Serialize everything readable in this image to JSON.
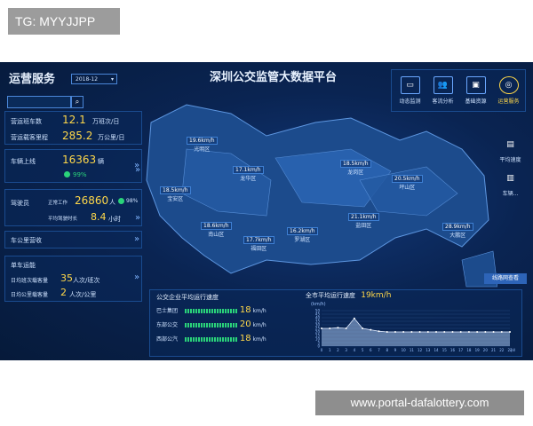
{
  "badge": "TG: MYYJJPP",
  "watermark": "www.portal-dafalottery.com",
  "header": {
    "title": "深圳公交监管大数据平台",
    "panel_title": "运营服务",
    "date": "2018-12"
  },
  "left": {
    "ops_vehicles_label": "营运班车数",
    "ops_vehicles_value": "12.1",
    "ops_vehicles_unit": "万班次/日",
    "ops_mileage_label": "营运载客里程",
    "ops_mileage_value": "285.2",
    "ops_mileage_unit": "万公里/日",
    "online_label": "车辆上线",
    "online_value": "16363",
    "online_unit": "辆",
    "online_pct": "99%",
    "drivers_label": "驾驶员",
    "drivers_working_label": "正常工作",
    "drivers_value": "26860",
    "drivers_unit": "人",
    "drivers_pct": "98%",
    "avg_drive_label": "平均驾驶时长",
    "avg_drive_value": "8.4",
    "avg_drive_unit": "小时",
    "revenue_label": "车公里营收",
    "single_ops_label": "单车运能",
    "daily_trips_label": "日均班次载客量",
    "daily_trips_value": "35",
    "daily_trips_unit": "人次/班次",
    "daily_km_label": "日均公里载客量",
    "daily_km_value": "2",
    "daily_km_unit": "人次/公里"
  },
  "top_buttons": [
    {
      "label": "动态监测"
    },
    {
      "label": "客流分析"
    },
    {
      "label": "基础资源"
    },
    {
      "label": "运营服务"
    }
  ],
  "side_buttons": [
    {
      "label": "平均速度"
    },
    {
      "label": "车辆..."
    }
  ],
  "districts": [
    {
      "name": "光明区",
      "speed": "19.6km/h"
    },
    {
      "name": "龙华区",
      "speed": "17.1km/h"
    },
    {
      "name": "龙岗区",
      "speed": "18.5km/h"
    },
    {
      "name": "坪山区",
      "speed": "20.5km/h"
    },
    {
      "name": "宝安区",
      "speed": "18.5km/h"
    },
    {
      "name": "南山区",
      "speed": "18.6km/h"
    },
    {
      "name": "福田区",
      "speed": "17.7km/h"
    },
    {
      "name": "罗湖区",
      "speed": "16.2km/h"
    },
    {
      "name": "盐田区",
      "speed": "21.1km/h"
    },
    {
      "name": "大鹏区",
      "speed": "28.9km/h"
    }
  ],
  "btn_more": "线路网查看",
  "bottom_left": {
    "title": "公交企业平均运行速度",
    "rows": [
      {
        "name": "巴士集团",
        "value": "18",
        "unit": "km/h"
      },
      {
        "name": "东部公交",
        "value": "20",
        "unit": "km/h"
      },
      {
        "name": "西部公汽",
        "value": "18",
        "unit": "km/h"
      }
    ]
  },
  "bottom_right": {
    "title": "全市平均运行速度",
    "value": "19km/h",
    "y_unit": "(km/h)"
  },
  "chart_data": {
    "type": "area",
    "title": "全市平均运行速度",
    "x": [
      0,
      1,
      2,
      3,
      4,
      5,
      6,
      7,
      8,
      9,
      10,
      11,
      12,
      13,
      14,
      15,
      16,
      17,
      18,
      19,
      20,
      21,
      22,
      23
    ],
    "values": [
      25,
      25,
      26,
      25,
      39,
      25,
      23,
      21,
      20,
      20,
      20,
      20,
      20,
      20,
      20,
      20,
      20,
      20,
      20,
      20,
      20,
      20,
      20,
      20
    ],
    "ylim": [
      0,
      50
    ],
    "yticks": [
      0,
      5,
      10,
      15,
      20,
      25,
      30,
      35,
      40,
      45,
      50
    ],
    "x_unit": "小时"
  },
  "colors": {
    "bg": "#061a3a",
    "accent_yellow": "#ffd84a",
    "green": "#2ad37a",
    "line": "#cfe3ff"
  }
}
